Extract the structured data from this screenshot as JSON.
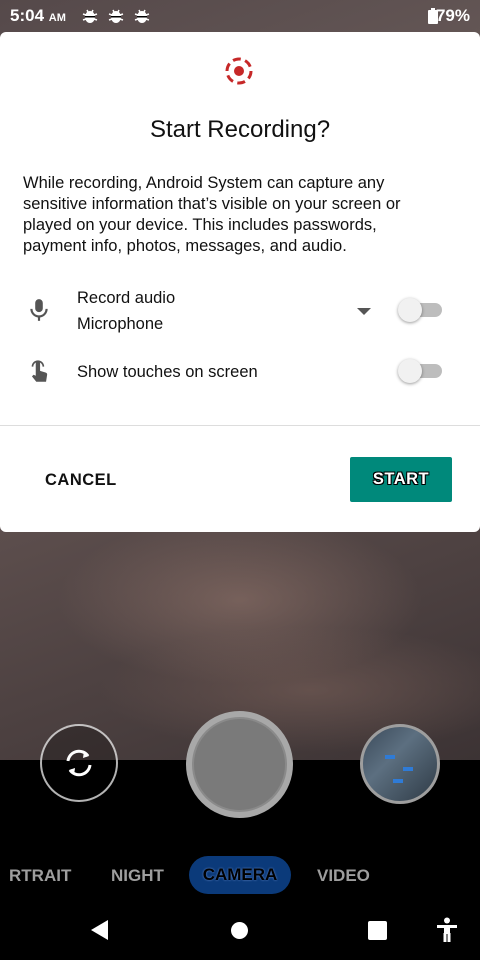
{
  "status_bar": {
    "time": "5:04",
    "ampm": "AM",
    "notification_icons": [
      "bug-icon",
      "bug-icon",
      "bug-icon"
    ],
    "battery_percent": "79%"
  },
  "dialog": {
    "icon": "screen-record-icon",
    "accent_color": "#c62828",
    "title": "Start Recording?",
    "body": "While recording, Android System can capture any sensitive information that’s visible on your screen or played on your device. This includes passwords, payment info, photos, messages, and audio.",
    "options": [
      {
        "icon": "microphone-icon",
        "label": "Record audio",
        "sublabel": "Microphone",
        "has_dropdown": true,
        "enabled": false
      },
      {
        "icon": "touch-icon",
        "label": "Show touches on screen",
        "enabled": false
      }
    ],
    "cancel_label": "CANCEL",
    "start_label": "START",
    "start_color": "#00897b"
  },
  "camera": {
    "modes": [
      "RTRAIT",
      "NIGHT",
      "CAMERA",
      "VIDEO"
    ],
    "active_mode": "CAMERA",
    "active_mode_color": "#0b3a7a"
  },
  "nav_bar": {
    "icons": [
      "back-icon",
      "home-icon",
      "recents-icon",
      "accessibility-icon"
    ]
  }
}
